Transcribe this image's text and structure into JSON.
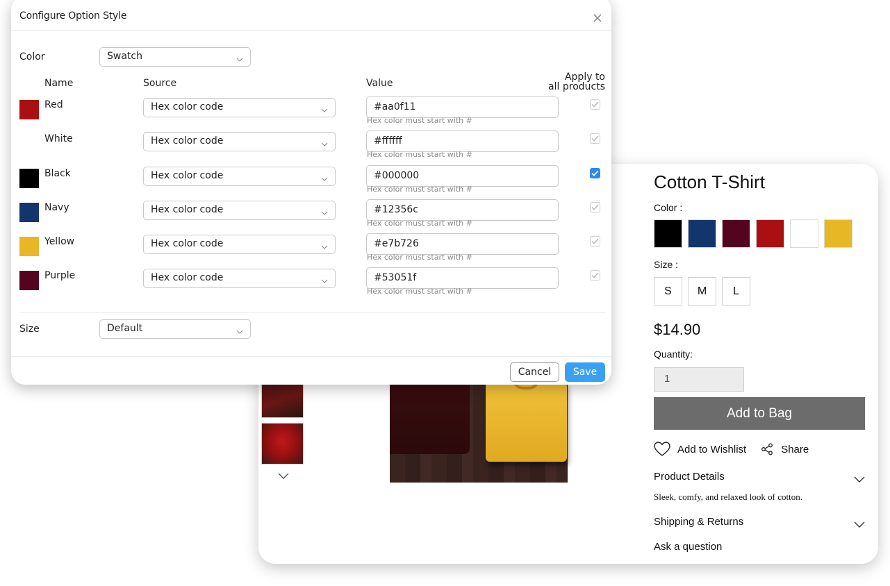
{
  "modal": {
    "title": "Configure Option Style",
    "color_label": "Color",
    "color_style": "Swatch",
    "columns": {
      "name": "Name",
      "source": "Source",
      "value": "Value",
      "apply_line1": "Apply to",
      "apply_line2": "all products"
    },
    "rows": [
      {
        "name": "Red",
        "swatch": "#aa0f11",
        "source": "Hex color code",
        "value": "#aa0f11",
        "hint": "Hex color must start with #",
        "apply_all": true,
        "apply_enabled": false
      },
      {
        "name": "White",
        "swatch": "#ffffff",
        "source": "Hex color code",
        "value": "#ffffff",
        "hint": "Hex color must start with #",
        "apply_all": true,
        "apply_enabled": false
      },
      {
        "name": "Black",
        "swatch": "#000000",
        "source": "Hex color code",
        "value": "#000000",
        "hint": "Hex color must start with #",
        "apply_all": true,
        "apply_enabled": true
      },
      {
        "name": "Navy",
        "swatch": "#12356c",
        "source": "Hex color code",
        "value": "#12356c",
        "hint": "Hex color must start with #",
        "apply_all": true,
        "apply_enabled": false
      },
      {
        "name": "Yellow",
        "swatch": "#e7b726",
        "source": "Hex color code",
        "value": "#e7b726",
        "hint": "Hex color must start with #",
        "apply_all": true,
        "apply_enabled": false
      },
      {
        "name": "Purple",
        "swatch": "#53051f",
        "source": "Hex color code",
        "value": "#53051f",
        "hint": "Hex color must start with #",
        "apply_all": true,
        "apply_enabled": false
      }
    ],
    "size_label": "Size",
    "size_style": "Default",
    "cancel_label": "Cancel",
    "save_label": "Save",
    "accent": "#3aa1f2"
  },
  "product": {
    "title": "Cotton T-Shirt",
    "color_label": "Color :",
    "swatches": [
      "#000000",
      "#12356c",
      "#53051f",
      "#aa0f11",
      "#ffffff",
      "#e7b726"
    ],
    "size_label": "Size :",
    "sizes": [
      "S",
      "M",
      "L"
    ],
    "price": "$14.90",
    "quantity_label": "Quantity:",
    "quantity": "1",
    "add_to_bag": "Add to Bag",
    "wishlist": "Add to Wishlist",
    "share": "Share",
    "details_heading": "Product Details",
    "details_text": "Sleek, comfy, and relaxed look of cotton.",
    "shipping_heading": "Shipping & Returns",
    "ask": "Ask a question"
  }
}
